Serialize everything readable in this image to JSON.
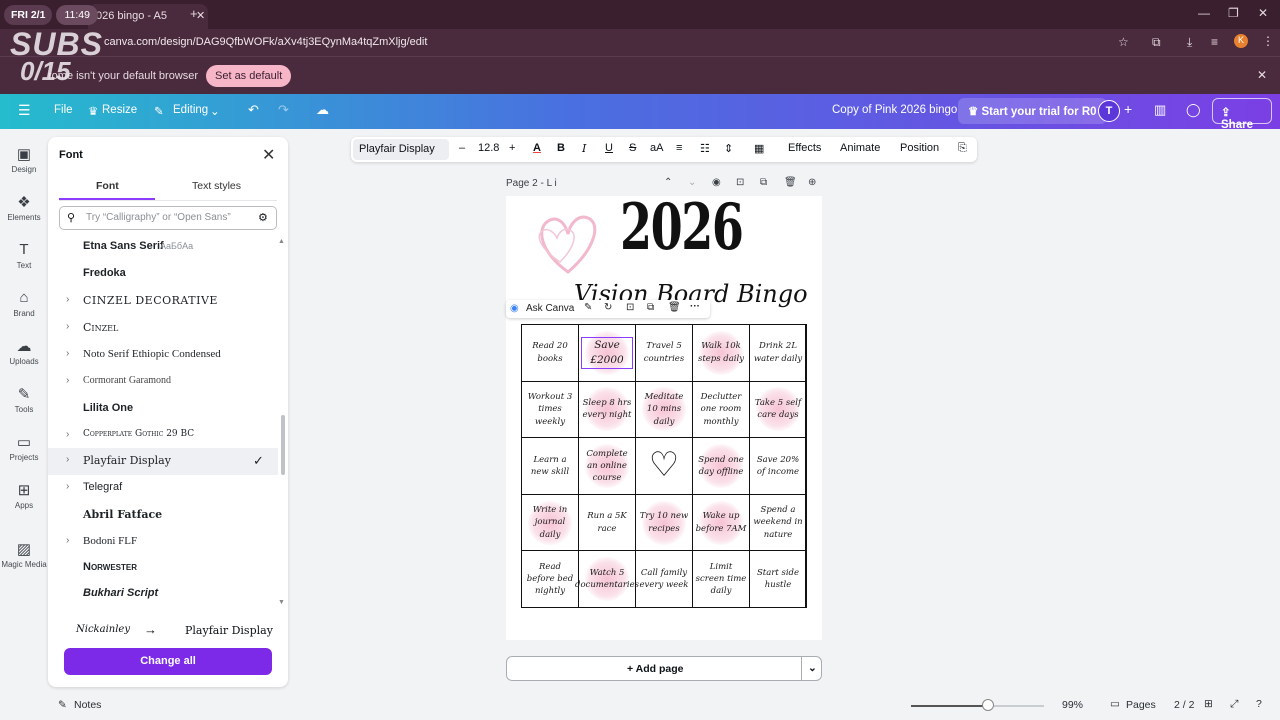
{
  "browser": {
    "date_label": "FRI 2/1",
    "time_label": "11:49",
    "tab_title": "026 bingo - A5",
    "url": "canva.com/design/DAG9QfbWOFk/aXv4tj3EQynMa4tqZmXljg/edit",
    "infobar_message": "rome isn't your default browser",
    "set_default_label": "Set as default",
    "profile_initial": "K"
  },
  "overlay": {
    "subs": "SUBS",
    "count": "0/15"
  },
  "topbar": {
    "file": "File",
    "resize": "Resize",
    "editing": "Editing",
    "doc_title": "Copy of Pink 2026 bingo",
    "trial": "Start your trial for R0",
    "avatar": "T",
    "share": "Share"
  },
  "rail": [
    {
      "label": "Design",
      "icon": "design-icon"
    },
    {
      "label": "Elements",
      "icon": "elements-icon"
    },
    {
      "label": "Text",
      "icon": "text-icon"
    },
    {
      "label": "Brand",
      "icon": "brand-icon"
    },
    {
      "label": "Uploads",
      "icon": "uploads-icon"
    },
    {
      "label": "Tools",
      "icon": "tools-icon"
    },
    {
      "label": "Projects",
      "icon": "projects-icon"
    },
    {
      "label": "Apps",
      "icon": "apps-icon"
    },
    {
      "label": "Magic Media",
      "icon": "magic-media-icon"
    }
  ],
  "panel": {
    "title": "Font",
    "tab_font": "Font",
    "tab_styles": "Text styles",
    "search_placeholder": "Try “Calligraphy” or “Open Sans”",
    "fonts": [
      {
        "name": "Etna Sans Serif",
        "sample": "AaБбAa",
        "expandable": false
      },
      {
        "name": "Fredoka",
        "expandable": false
      },
      {
        "name": "CINZEL DECORATIVE",
        "expandable": true
      },
      {
        "name": "Cinzel",
        "expandable": true
      },
      {
        "name": "Noto Serif Ethiopic Condensed",
        "expandable": true
      },
      {
        "name": "Cormorant Garamond",
        "expandable": true
      },
      {
        "name": "Lilita One",
        "expandable": false
      },
      {
        "name": "Copperplate Gothic 29 BC",
        "expandable": true
      },
      {
        "name": "Playfair Display",
        "expandable": true,
        "selected": true
      },
      {
        "name": "Telegraf",
        "expandable": true
      },
      {
        "name": "Abril Fatface",
        "expandable": false
      },
      {
        "name": "Bodoni FLF",
        "expandable": true
      },
      {
        "name": "Norwester",
        "expandable": false
      },
      {
        "name": "Bukhari Script",
        "expandable": false
      }
    ],
    "replace_from": "Nickainley",
    "replace_to": "Playfair Display",
    "change_all": "Change all"
  },
  "toolbar": {
    "font": "Playfair Display",
    "size": "12.8",
    "effects": "Effects",
    "animate": "Animate",
    "position": "Position"
  },
  "page": {
    "label": "Page 2 - L i",
    "title": "2026",
    "subtitle": "Vision Board Bingo",
    "ask_canva": "Ask Canva",
    "cells": [
      "Read 20 books",
      "Save £2000",
      "Travel 5 countries",
      "Walk 10k steps daily",
      "Drink 2L water daily",
      "Workout 3 times weekly",
      "Sleep 8 hrs every night",
      "Meditate 10 mins daily",
      "Declutter one room monthly",
      "Take 5 self care days",
      "Learn a new skill",
      "Complete an online course",
      "♡",
      "Spend one day offline",
      "Save 20% of income",
      "Write in journal daily",
      "Run a 5K race",
      "Try 10 new recipes",
      "Wake up before 7AM",
      "Spend a weekend in nature",
      "Read before bed nightly",
      "Watch 5 documentaries",
      "Call family every week",
      "Limit screen time daily",
      "Start side hustle"
    ],
    "add_page": "+ Add page"
  },
  "bottom": {
    "notes": "Notes",
    "zoom": "99%",
    "zoom_level": 0.58,
    "pages": "Pages",
    "page_count": "2 / 2"
  },
  "colors": {
    "accent": "#7d2ae8",
    "blob": "#f5b9cd"
  }
}
